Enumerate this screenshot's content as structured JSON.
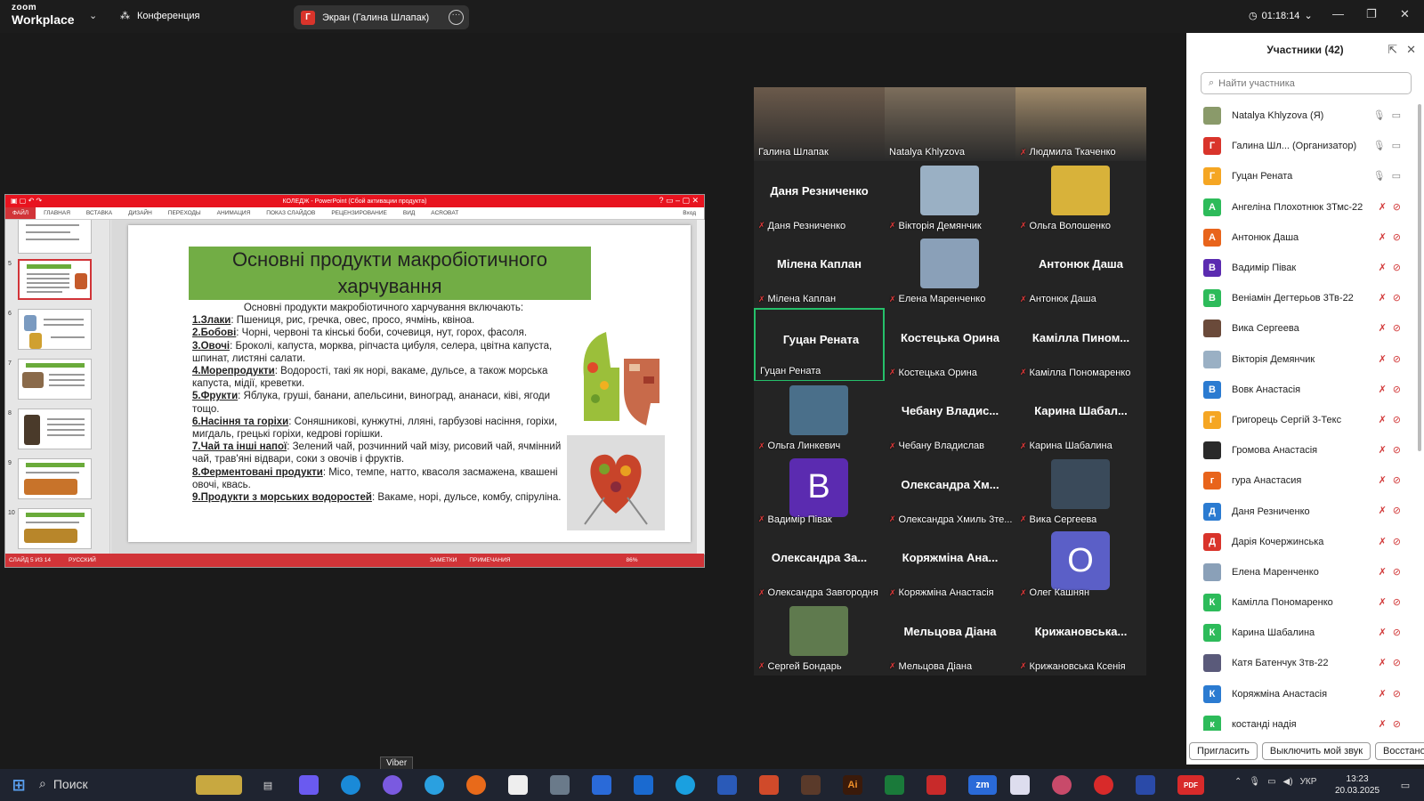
{
  "topbar": {
    "logo_top": "zoom",
    "logo_bottom": "Workplace",
    "conference_label": "Конференция",
    "screen_tab_avatar": "Г",
    "screen_tab_label": "Экран (Галина Шлапак)",
    "timer": "01:18:14"
  },
  "ppt": {
    "title": "КОЛЕДЖ - PowerPoint (Сбой активации продукта)",
    "ribbon_tabs": [
      "ФАЙЛ",
      "ГЛАВНАЯ",
      "ВСТАВКА",
      "ДИЗАЙН",
      "ПЕРЕХОДЫ",
      "АНИМАЦИЯ",
      "ПОКАЗ СЛАЙДОВ",
      "РЕЦЕНЗИРОВАНИЕ",
      "ВИД",
      "ACROBAT"
    ],
    "signin": "Вход",
    "thumb_numbers": [
      "5",
      "6",
      "7",
      "8",
      "9",
      "10"
    ],
    "status_left": "СЛАЙД 5 ИЗ 14",
    "status_lang": "РУССКИЙ",
    "status_notes": "ЗАМЕТКИ",
    "status_comments": "ПРИМЕЧАНИЯ",
    "zoom_level": "86%",
    "slide": {
      "title": "Основні продукти макробіотичного харчування",
      "intro": "Основні продукти макробіотичного харчування включають:",
      "items": [
        {
          "head": "1.Злаки",
          "text": ": Пшениця, рис, гречка, овес, просо, ячмінь, квіноа."
        },
        {
          "head": "2.Бобові",
          "text": ": Чорні, червоні та кінські боби, сочевиця, нут, горох, фасоля."
        },
        {
          "head": "3.Овочі",
          "text": ": Броколі, капуста, морква, ріпчаста цибуля, селера, цвітна капуста, шпинат, листяні салати."
        },
        {
          "head": "4.Морепродукти",
          "text": ": Водорості, такі як норі, вакаме, дульсе, а також морська капуста, мідії, креветки."
        },
        {
          "head": "5.Фрукти",
          "text": ": Яблука, груші, банани, апельсини, виноград, ананаси, ківі, ягоди тощо."
        },
        {
          "head": "6.Насіння та горіхи",
          "text": ": Соняшникові, кунжутні, лляні, гарбузові насіння, горіхи, мигдаль, грецькі горіхи, кедрові горішки."
        },
        {
          "head": "7.Чай та інші напої",
          "text": ": Зелений чай, розчинний чай мізу, рисовий чай, ячмінний чай, трав'яні відвари, соки з овочів і фруктів."
        },
        {
          "head": "8.Ферментовані продукти",
          "text": ": Місо, темпе, натто, квасоля засмажена, квашені овочі, квась."
        },
        {
          "head": "9.Продукти з морських водоростей",
          "text": ": Вакаме, норі, дульсе, комбу, спіруліна."
        }
      ]
    }
  },
  "tiles": [
    {
      "name": "Галина Шлапак",
      "big": "",
      "muted": false,
      "kind": "photo",
      "color": "#6b5a4b"
    },
    {
      "name": "Natalya Khlyzova",
      "big": "",
      "muted": false,
      "kind": "photo",
      "color": "#7d6e5c"
    },
    {
      "name": "Людмила Ткаченко",
      "big": "",
      "muted": true,
      "kind": "photo",
      "color": "#a08a6a"
    },
    {
      "name": "Даня Резниченко",
      "big": "Даня Резниченко",
      "muted": true,
      "kind": "text",
      "color": ""
    },
    {
      "name": "Вікторія Демянчик",
      "big": "",
      "muted": true,
      "kind": "pic",
      "color": "#9ab0c4"
    },
    {
      "name": "Ольга Волошенко",
      "big": "",
      "muted": true,
      "kind": "pic",
      "color": "#d8b23a"
    },
    {
      "name": "Мілена Каплан",
      "big": "Мілена Каплан",
      "muted": true,
      "kind": "text",
      "color": ""
    },
    {
      "name": "Елена Маренченко",
      "big": "",
      "muted": true,
      "kind": "pic",
      "color": "#8aa0b8"
    },
    {
      "name": "Антонюк Даша",
      "big": "Антонюк Даша",
      "muted": true,
      "kind": "text",
      "color": ""
    },
    {
      "name": "Гуцан Рената",
      "big": "Гуцан Рената",
      "muted": false,
      "kind": "text",
      "color": "",
      "active": true
    },
    {
      "name": "Костецька Орина",
      "big": "Костецька Орина",
      "muted": true,
      "kind": "text",
      "color": ""
    },
    {
      "name": "Камілла Пономаренко",
      "big": "Камілла Пином...",
      "muted": true,
      "kind": "text",
      "color": ""
    },
    {
      "name": "Ольга Линкевич",
      "big": "",
      "muted": true,
      "kind": "pic",
      "color": "#4a6f8a"
    },
    {
      "name": "Чебану Владислав",
      "big": "Чебану Владис...",
      "muted": true,
      "kind": "text",
      "color": ""
    },
    {
      "name": "Карина Шабалина",
      "big": "Карина Шабал...",
      "muted": true,
      "kind": "text",
      "color": ""
    },
    {
      "name": "Вадимір Півак",
      "big": "В",
      "muted": true,
      "kind": "avatar",
      "color": "#5b2bb0"
    },
    {
      "name": "Олександра Хмиль 3те...",
      "big": "Олександра Хм...",
      "muted": true,
      "kind": "text",
      "color": ""
    },
    {
      "name": "Вика Сергеева",
      "big": "",
      "muted": true,
      "kind": "pic",
      "color": "#3a4a5a"
    },
    {
      "name": "Олександра Завгородня",
      "big": "Олександра За...",
      "muted": true,
      "kind": "text",
      "color": ""
    },
    {
      "name": "Коряжміна Анастасія",
      "big": "Коряжміна Ана...",
      "muted": true,
      "kind": "text",
      "color": ""
    },
    {
      "name": "Олег Кашнян",
      "big": "О",
      "muted": true,
      "kind": "avatar",
      "color": "#5b5fc7"
    },
    {
      "name": "Сергей Бондарь",
      "big": "",
      "muted": true,
      "kind": "pic",
      "color": "#5f7a4e"
    },
    {
      "name": "Мельцова Діана",
      "big": "Мельцова Діана",
      "muted": true,
      "kind": "text",
      "color": ""
    },
    {
      "name": "Крижановська Ксенія",
      "big": "Крижановська...",
      "muted": true,
      "kind": "text",
      "color": ""
    }
  ],
  "panel": {
    "title": "Участники (42)",
    "search_placeholder": "Найти участника",
    "participants": [
      {
        "name": "Natalya Khlyzova (Я)",
        "letter": "",
        "color": "#8a9a6a",
        "muted": false
      },
      {
        "name": "Галина Шл... (Организатор)",
        "letter": "Г",
        "color": "#d9342b",
        "muted": false
      },
      {
        "name": "Гуцан Рената",
        "letter": "Г",
        "color": "#f5a623",
        "muted": false
      },
      {
        "name": "Ангеліна Плохотнюк 3Тмс-22",
        "letter": "А",
        "color": "#2dbb5a",
        "muted": true
      },
      {
        "name": "Антонюк Даша",
        "letter": "А",
        "color": "#e8641b",
        "muted": true
      },
      {
        "name": "Вадимір Півак",
        "letter": "В",
        "color": "#5b2bb0",
        "muted": true
      },
      {
        "name": "Веніамін Дегтерьов 3Тв-22",
        "letter": "В",
        "color": "#2dbb5a",
        "muted": true
      },
      {
        "name": "Вика Сергеева",
        "letter": "",
        "color": "#6a4a3a",
        "muted": true
      },
      {
        "name": "Вікторія Демянчик",
        "letter": "",
        "color": "#9ab0c4",
        "muted": true
      },
      {
        "name": "Вовк Анастасія",
        "letter": "В",
        "color": "#2b7bd1",
        "muted": true
      },
      {
        "name": "Григорець Сергій 3-Текс",
        "letter": "Г",
        "color": "#f5a623",
        "muted": true
      },
      {
        "name": "Громова Анастасія",
        "letter": "",
        "color": "#2a2a2a",
        "muted": true
      },
      {
        "name": "гура Анастасия",
        "letter": "г",
        "color": "#e8641b",
        "muted": true
      },
      {
        "name": "Даня Резниченко",
        "letter": "Д",
        "color": "#2b7bd1",
        "muted": true
      },
      {
        "name": "Дарія Кочержинська",
        "letter": "Д",
        "color": "#d9342b",
        "muted": true
      },
      {
        "name": "Елена Маренченко",
        "letter": "",
        "color": "#8aa0b8",
        "muted": true
      },
      {
        "name": "Камілла Пономаренко",
        "letter": "К",
        "color": "#2dbb5a",
        "muted": true
      },
      {
        "name": "Карина Шабалина",
        "letter": "К",
        "color": "#2dbb5a",
        "muted": true
      },
      {
        "name": "Катя Батенчук 3тв-22",
        "letter": "",
        "color": "#5a5a7a",
        "muted": true
      },
      {
        "name": "Коряжміна Анастасія",
        "letter": "К",
        "color": "#2b7bd1",
        "muted": true
      },
      {
        "name": "костанді надія",
        "letter": "к",
        "color": "#2dbb5a",
        "muted": true
      }
    ],
    "btn_invite": "Пригласить",
    "btn_mute_me": "Выключить мой звук",
    "btn_restore": "Восстанови"
  },
  "taskbar": {
    "search_label": "Поиск",
    "tooltip": "Viber",
    "lang": "УКР",
    "time": "13:23",
    "date": "20.03.2025"
  }
}
